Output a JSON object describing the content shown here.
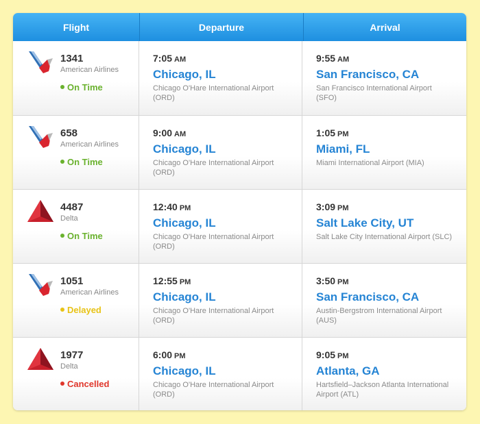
{
  "header": {
    "flight": "Flight",
    "departure": "Departure",
    "arrival": "Arrival"
  },
  "colors": {
    "on_time": "#6ab22e",
    "delayed": "#e8c317",
    "cancelled": "#e0362b",
    "city": "#2584d4"
  },
  "flights": [
    {
      "number": "1341",
      "airline": "American Airlines",
      "logo": "american-airlines-logo",
      "status": "On Time",
      "status_kind": "on_time",
      "dep_time": "7:05",
      "dep_ampm": "AM",
      "dep_city": "Chicago, IL",
      "dep_airport": "Chicago O'Hare International Airport (ORD)",
      "arr_time": "9:55",
      "arr_ampm": "AM",
      "arr_city": "San Francisco, CA",
      "arr_airport": "San Francisco International Airport (SFO)"
    },
    {
      "number": "658",
      "airline": "American Airlines",
      "logo": "american-airlines-logo",
      "status": "On Time",
      "status_kind": "on_time",
      "dep_time": "9:00",
      "dep_ampm": "AM",
      "dep_city": "Chicago, IL",
      "dep_airport": "Chicago O'Hare International Airport (ORD)",
      "arr_time": "1:05",
      "arr_ampm": "PM",
      "arr_city": "Miami, FL",
      "arr_airport": "Miami International Airport (MIA)"
    },
    {
      "number": "4487",
      "airline": "Delta",
      "logo": "delta-logo",
      "status": "On Time",
      "status_kind": "on_time",
      "dep_time": "12:40",
      "dep_ampm": "PM",
      "dep_city": "Chicago, IL",
      "dep_airport": "Chicago O'Hare International Airport (ORD)",
      "arr_time": "3:09",
      "arr_ampm": "PM",
      "arr_city": "Salt Lake City, UT",
      "arr_airport": "Salt Lake City International Airport (SLC)"
    },
    {
      "number": "1051",
      "airline": "American Airlines",
      "logo": "american-airlines-logo",
      "status": "Delayed",
      "status_kind": "delayed",
      "dep_time": "12:55",
      "dep_ampm": "PM",
      "dep_city": "Chicago, IL",
      "dep_airport": "Chicago O'Hare International Airport (ORD)",
      "arr_time": "3:50",
      "arr_ampm": "PM",
      "arr_city": "San Francisco, CA",
      "arr_airport": "Austin-Bergstrom International Airport (AUS)"
    },
    {
      "number": "1977",
      "airline": "Delta",
      "logo": "delta-logo",
      "status": "Cancelled",
      "status_kind": "cancelled",
      "dep_time": "6:00",
      "dep_ampm": "PM",
      "dep_city": "Chicago, IL",
      "dep_airport": "Chicago O'Hare International Airport (ORD)",
      "arr_time": "9:05",
      "arr_ampm": "PM",
      "arr_city": "Atlanta, GA",
      "arr_airport": "Hartsfield–Jackson Atlanta International Airport (ATL)"
    }
  ]
}
